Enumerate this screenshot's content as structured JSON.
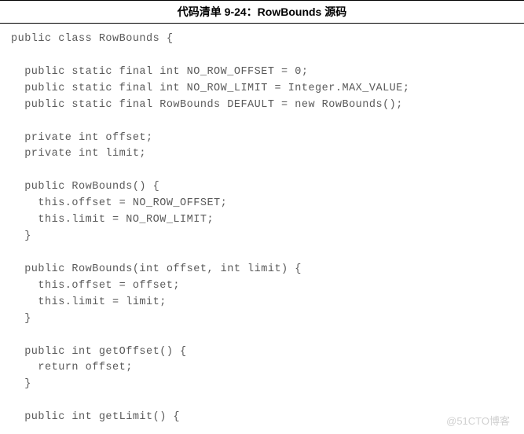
{
  "title": "代码清单 9-24：RowBounds 源码",
  "code": {
    "line01": "public class RowBounds {",
    "line02": "",
    "line03": "  public static final int NO_ROW_OFFSET = 0;",
    "line04": "  public static final int NO_ROW_LIMIT = Integer.MAX_VALUE;",
    "line05": "  public static final RowBounds DEFAULT = new RowBounds();",
    "line06": "",
    "line07": "  private int offset;",
    "line08": "  private int limit;",
    "line09": "",
    "line10": "  public RowBounds() {",
    "line11": "    this.offset = NO_ROW_OFFSET;",
    "line12": "    this.limit = NO_ROW_LIMIT;",
    "line13": "  }",
    "line14": "",
    "line15": "  public RowBounds(int offset, int limit) {",
    "line16": "    this.offset = offset;",
    "line17": "    this.limit = limit;",
    "line18": "  }",
    "line19": "",
    "line20": "  public int getOffset() {",
    "line21": "    return offset;",
    "line22": "  }",
    "line23": "",
    "line24": "  public int getLimit() {"
  },
  "watermark": "@51CTO博客"
}
